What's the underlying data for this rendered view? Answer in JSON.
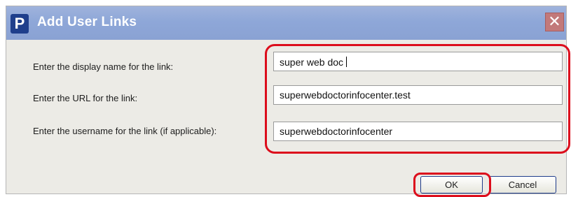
{
  "window": {
    "title": "Add User Links",
    "app_icon_letter": "P",
    "close_glyph": "✕"
  },
  "form": {
    "display_name_label": "Enter the display name for the link:",
    "display_name_value": "super web doc",
    "url_label": "Enter the URL for the link:",
    "url_value": "superwebdoctorinfocenter.test",
    "username_label": "Enter the username for the link (if applicable):",
    "username_value": "superwebdoctorinfocenter"
  },
  "buttons": {
    "ok_label": "OK",
    "cancel_label": "Cancel"
  },
  "annotation": {
    "highlight_color": "#dc0d1c"
  }
}
